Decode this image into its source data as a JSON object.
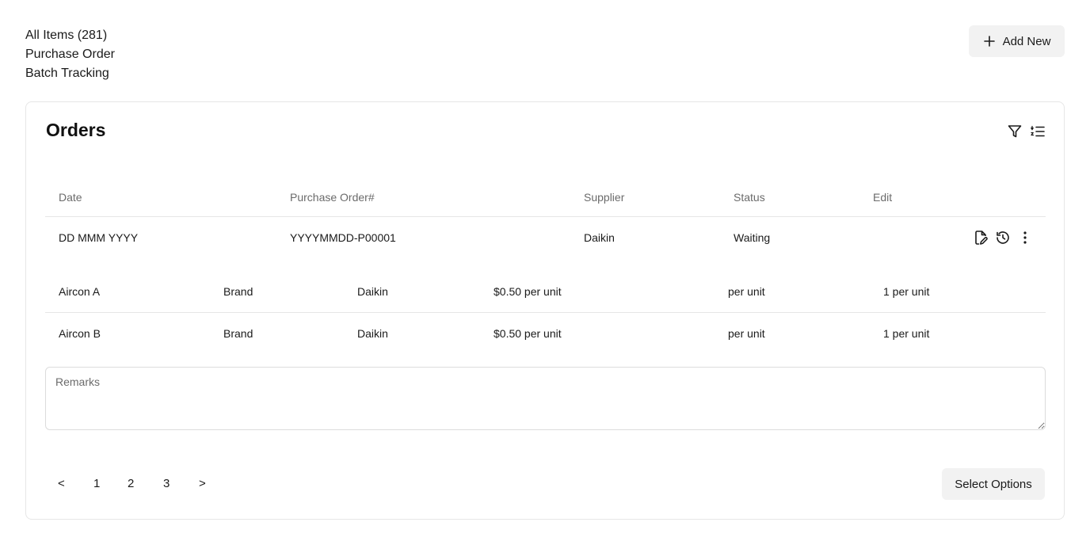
{
  "nav": {
    "items": [
      "All Items (281)",
      "Purchase Order",
      "Batch Tracking"
    ]
  },
  "header": {
    "add_new_label": "Add New"
  },
  "card": {
    "title": "Orders",
    "columns": [
      "Date",
      "Purchase Order#",
      "Supplier",
      "Status",
      "Edit"
    ],
    "order": {
      "date": "DD MMM YYYY",
      "po_number": "YYYYMMDD-P00001",
      "supplier": "Daikin",
      "status": "Waiting"
    },
    "items": [
      {
        "name": "Aircon A",
        "brand_label": "Brand",
        "brand": "Daikin",
        "price": "$0.50 per unit",
        "unit": "per unit",
        "qty": "1 per unit"
      },
      {
        "name": "Aircon B",
        "brand_label": "Brand",
        "brand": "Daikin",
        "price": "$0.50 per unit",
        "unit": "per unit",
        "qty": "1 per unit"
      }
    ],
    "remarks_placeholder": "Remarks",
    "pagination": {
      "prev": "<",
      "pages": [
        "1",
        "2",
        "3"
      ],
      "next": ">"
    },
    "select_options_label": "Select Options"
  },
  "icons": {
    "add": "plus-icon",
    "filter": "filter-icon",
    "sort": "sort-list-icon",
    "edit": "file-edit-icon",
    "history": "history-icon",
    "more": "more-vertical-icon"
  }
}
